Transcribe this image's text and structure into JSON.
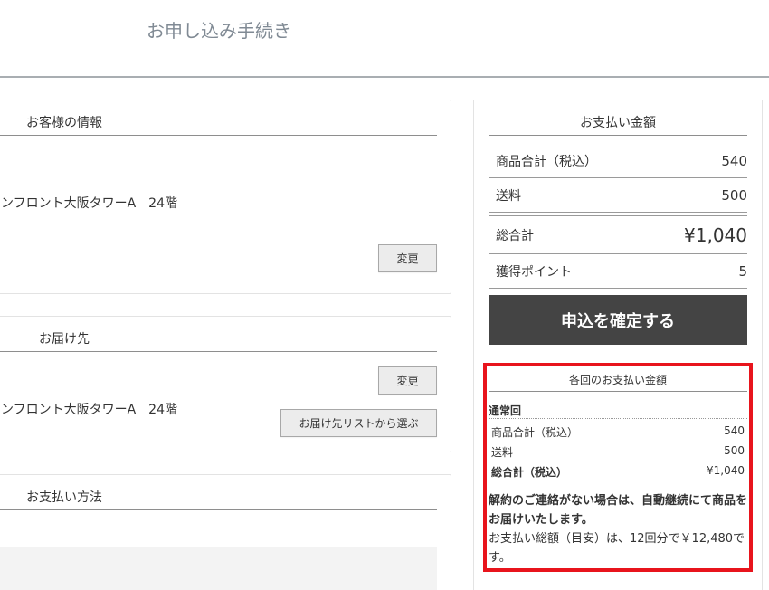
{
  "page": {
    "title": "お申し込み手続き"
  },
  "customer": {
    "heading": "お客様の情報",
    "address": "ンフロント大阪タワーA　24階",
    "change_label": "変更"
  },
  "delivery": {
    "heading": "お届け先",
    "address": "ンフロント大阪タワーA　24階",
    "change_label": "変更",
    "list_label": "お届け先リストから選ぶ"
  },
  "payment_method": {
    "heading": "お支払い方法"
  },
  "payment_summary": {
    "heading": "お支払い金額",
    "rows": [
      {
        "label": "商品合計（税込）",
        "value": "540"
      },
      {
        "label": "送料",
        "value": "500"
      },
      {
        "label": "総合計",
        "value": "¥1,040"
      },
      {
        "label": "獲得ポイント",
        "value": "5"
      }
    ],
    "confirm_label": "申込を確定する"
  },
  "per_delivery": {
    "heading": "各回のお支払い金額",
    "section_label": "通常回",
    "rows": [
      {
        "label": "商品合計（税込）",
        "value": "540"
      },
      {
        "label": "送料",
        "value": "500"
      },
      {
        "label": "総合計（税込）",
        "value": "¥1,040"
      }
    ],
    "note_bold": "解約のご連絡がない場合は、自動継続にて商品をお届けいたします。",
    "note_text": "お支払い総額（目安）は、12回分で￥12,480です。"
  },
  "colors": {
    "highlight": "#e8141c",
    "confirm_button": "#444444"
  }
}
